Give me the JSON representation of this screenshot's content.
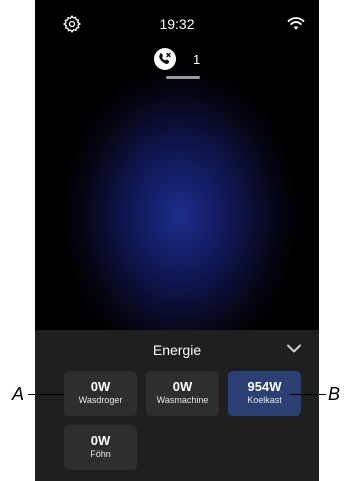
{
  "status": {
    "time": "19:32",
    "icons": [
      "gear-icon",
      "wifi-icon"
    ]
  },
  "notification": {
    "icon": "missed-call-icon",
    "count": "1"
  },
  "panel": {
    "title": "Energie",
    "collapse_icon": "chevron-down-icon",
    "tiles": [
      {
        "value": "0W",
        "label": "Wasdroger"
      },
      {
        "value": "0W",
        "label": "Wasmachine"
      },
      {
        "value": "954W",
        "label": "Koelkast",
        "active": true
      },
      {
        "value": "0W",
        "label": "Föhn"
      }
    ]
  },
  "callouts": {
    "a": "A",
    "b": "B"
  },
  "colors": {
    "active_tile": "#2b3f72",
    "tile": "#2e2e2e",
    "panel": "#1f1f1f"
  }
}
